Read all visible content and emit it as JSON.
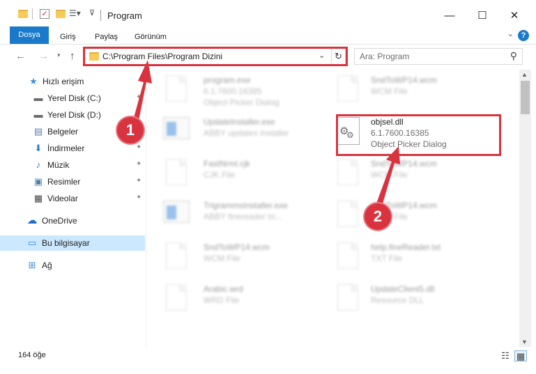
{
  "window": {
    "title": "Program",
    "minimize": "—",
    "maximize": "☐",
    "close": "✕"
  },
  "ribbon": {
    "tabs": [
      "Dosya",
      "Giriş",
      "Paylaş",
      "Görünüm"
    ],
    "help": "?",
    "collapse": "⌄"
  },
  "address": {
    "path": "C:\\Program Files\\Program Dizini",
    "search_placeholder": "Ara: Program"
  },
  "sidebar": {
    "items": [
      {
        "label": "Hızlı erişim",
        "icon": "star-icon",
        "glyph": "★",
        "color": "#3b8ee3",
        "pinned": false
      },
      {
        "label": "Yerel Disk (C:)",
        "icon": "drive-icon",
        "glyph": "▬",
        "color": "#6a6a6a",
        "pinned": true
      },
      {
        "label": "Yerel Disk (D:)",
        "icon": "drive-icon",
        "glyph": "▬",
        "color": "#6a6a6a",
        "pinned": true
      },
      {
        "label": "Belgeler",
        "icon": "documents-icon",
        "glyph": "▤",
        "color": "#5a7fa8",
        "pinned": true
      },
      {
        "label": "İndirmeler",
        "icon": "download-icon",
        "glyph": "⬇",
        "color": "#2a7bd4",
        "pinned": true
      },
      {
        "label": "Müzik",
        "icon": "music-icon",
        "glyph": "♪",
        "color": "#2a7bd4",
        "pinned": true
      },
      {
        "label": "Resimler",
        "icon": "pictures-icon",
        "glyph": "▣",
        "color": "#4f7fb0",
        "pinned": true
      },
      {
        "label": "Videolar",
        "icon": "videos-icon",
        "glyph": "▦",
        "color": "#444444",
        "pinned": true
      },
      {
        "label": "OneDrive",
        "icon": "cloud-icon",
        "glyph": "☁",
        "color": "#1e6fc7",
        "pinned": false
      },
      {
        "label": "Bu bilgisayar",
        "icon": "computer-icon",
        "glyph": "▭",
        "color": "#2f8fe0",
        "pinned": false
      },
      {
        "label": "Ağ",
        "icon": "network-icon",
        "glyph": "⊞",
        "color": "#2f8fe0",
        "pinned": false
      }
    ]
  },
  "files": {
    "program_exe": {
      "name": "program.exe",
      "line2": "6.1.7600.16385",
      "line3": "Object Picker Dialog"
    },
    "sndtowp14_1": {
      "name": "SndToWP14.wcm",
      "line2": "WCM File"
    },
    "updateinstaller": {
      "name": "UpdateInstaller.exe",
      "line2": "ABBY updates installer"
    },
    "objsel": {
      "name": "objsel.dll",
      "line2": "6.1.7600.16385",
      "line3": "Object Picker Dialog"
    },
    "fastnrml": {
      "name": "FastNrml.cjk",
      "line2": "CJK File"
    },
    "sndtowp14_2": {
      "name": "SndToWP14.wcm",
      "line2": "WCM File"
    },
    "trigrams": {
      "name": "TrigrammsInstaller.exe",
      "line2": "ABBY finereader tri..."
    },
    "sndtowp14_3": {
      "name": "SndToWP14.wcm",
      "line2": "WCM File"
    },
    "sndtowp14_4": {
      "name": "SndToWP14.wcm",
      "line2": "WCM File"
    },
    "help_txt": {
      "name": "help.fineReader.txt",
      "line2": "TXT File"
    },
    "arabic": {
      "name": "Arabic.wrd",
      "line2": "WRD File"
    },
    "updateclient": {
      "name": "UpdateClient5.dll",
      "line2": "Resource DLL"
    }
  },
  "status": {
    "count": "164 öğe"
  },
  "callouts": {
    "one": "1",
    "two": "2"
  },
  "colors": {
    "accent": "#1979ca",
    "highlight": "#d9333f",
    "selected": "#cce8ff"
  }
}
